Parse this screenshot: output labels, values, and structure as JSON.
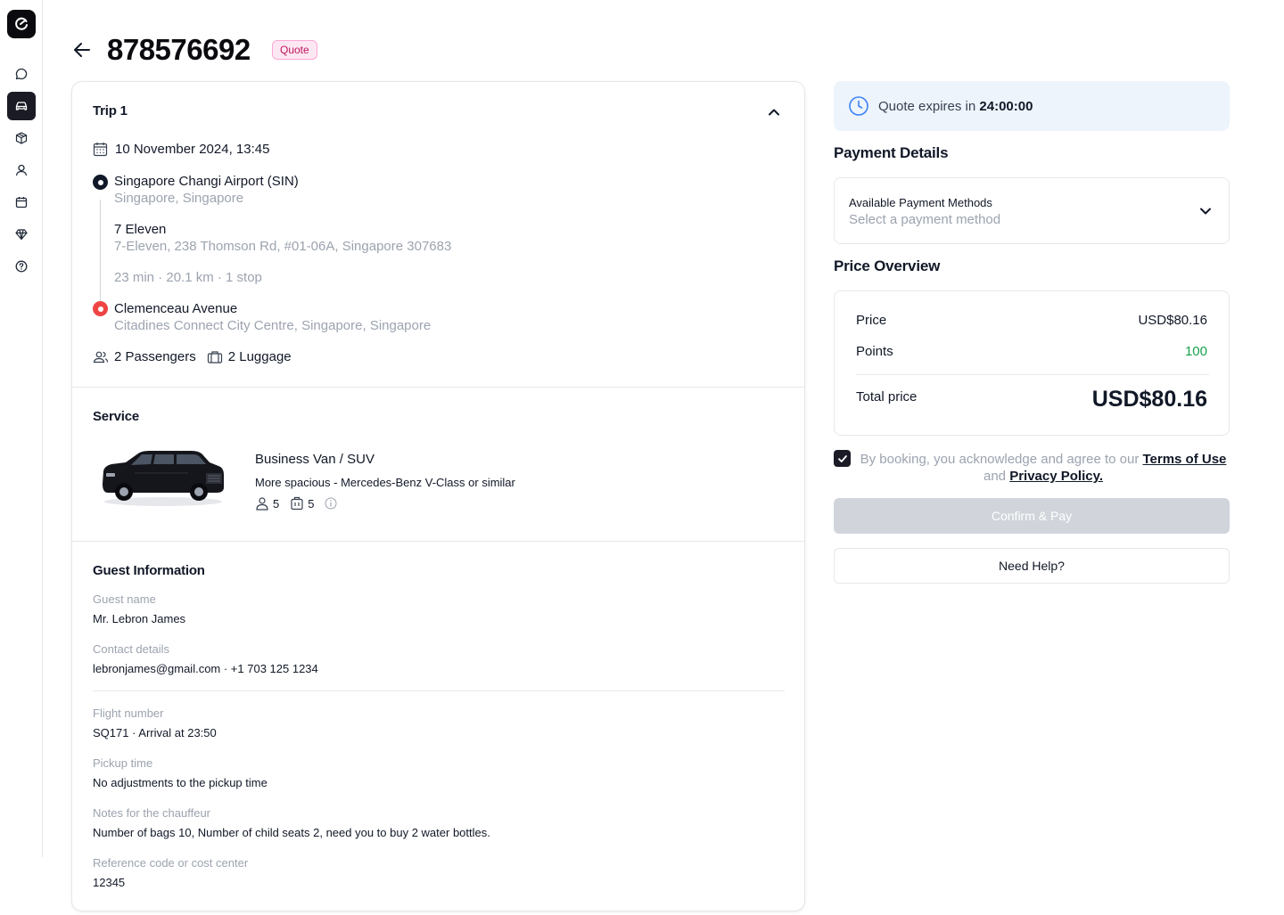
{
  "header": {
    "order_id": "878576692",
    "status_badge": "Quote"
  },
  "sidebar": {
    "items": [
      {
        "icon": "chat-icon"
      },
      {
        "icon": "car-icon",
        "active": true
      },
      {
        "icon": "box-icon"
      },
      {
        "icon": "user-icon"
      },
      {
        "icon": "calendar-icon"
      },
      {
        "icon": "diamond-icon"
      },
      {
        "icon": "help-icon"
      }
    ]
  },
  "trip": {
    "title": "Trip 1",
    "datetime": "10 November 2024, 13:45",
    "pickup": {
      "name": "Singapore Changi Airport (SIN)",
      "address": "Singapore, Singapore"
    },
    "stop": {
      "name": "7 Eleven",
      "address": "7-Eleven, 238 Thomson Rd, #01-06A, Singapore 307683"
    },
    "summary": "23 min · 20.1 km · 1 stop",
    "dropoff": {
      "name": "Clemenceau Avenue",
      "address": "Citadines Connect City Centre, Singapore, Singapore"
    },
    "passengers": "2 Passengers",
    "luggage": "2 Luggage"
  },
  "service": {
    "title": "Service",
    "name": "Business Van / SUV",
    "description": "More spacious - Mercedes-Benz V-Class or similar",
    "max_passengers": "5",
    "max_luggage": "5"
  },
  "guest": {
    "title": "Guest Information",
    "fields": [
      {
        "label": "Guest name",
        "value": "Mr. Lebron James"
      },
      {
        "label": "Contact details",
        "value": "lebronjames@gmail.com · +1 703 125 1234"
      },
      {
        "label": "Flight number",
        "value": "SQ171 · Arrival at 23:50"
      },
      {
        "label": "Pickup time",
        "value": "No adjustments to the pickup time"
      },
      {
        "label": "Notes for the chauffeur",
        "value": "Number of bags 10, Number of child seats 2, need you to buy 2 water bottles."
      },
      {
        "label": "Reference code or cost center",
        "value": "12345"
      }
    ]
  },
  "expiry": {
    "text": "Quote expires in",
    "time": "24:00:00"
  },
  "payment": {
    "title": "Payment Details",
    "methods_label": "Available Payment Methods",
    "placeholder": "Select a payment method"
  },
  "price": {
    "title": "Price Overview",
    "price_label": "Price",
    "price_value": "USD$80.16",
    "points_label": "Points",
    "points_value": "100",
    "total_label": "Total price",
    "total_value": "USD$80.16"
  },
  "agreement": {
    "text_before": "By booking, you acknowledge and agree to our",
    "terms": "Terms of Use",
    "and": "and",
    "privacy": "Privacy Policy."
  },
  "actions": {
    "confirm": "Confirm & Pay",
    "help": "Need Help?"
  },
  "colors": {
    "accent_dark": "#1a1b24",
    "badge_pink": "#be185d",
    "points_green": "#16a34a",
    "dropoff_red": "#ef4444",
    "expiry_bg": "#eef4fb",
    "clock_blue": "#3b82f6"
  }
}
